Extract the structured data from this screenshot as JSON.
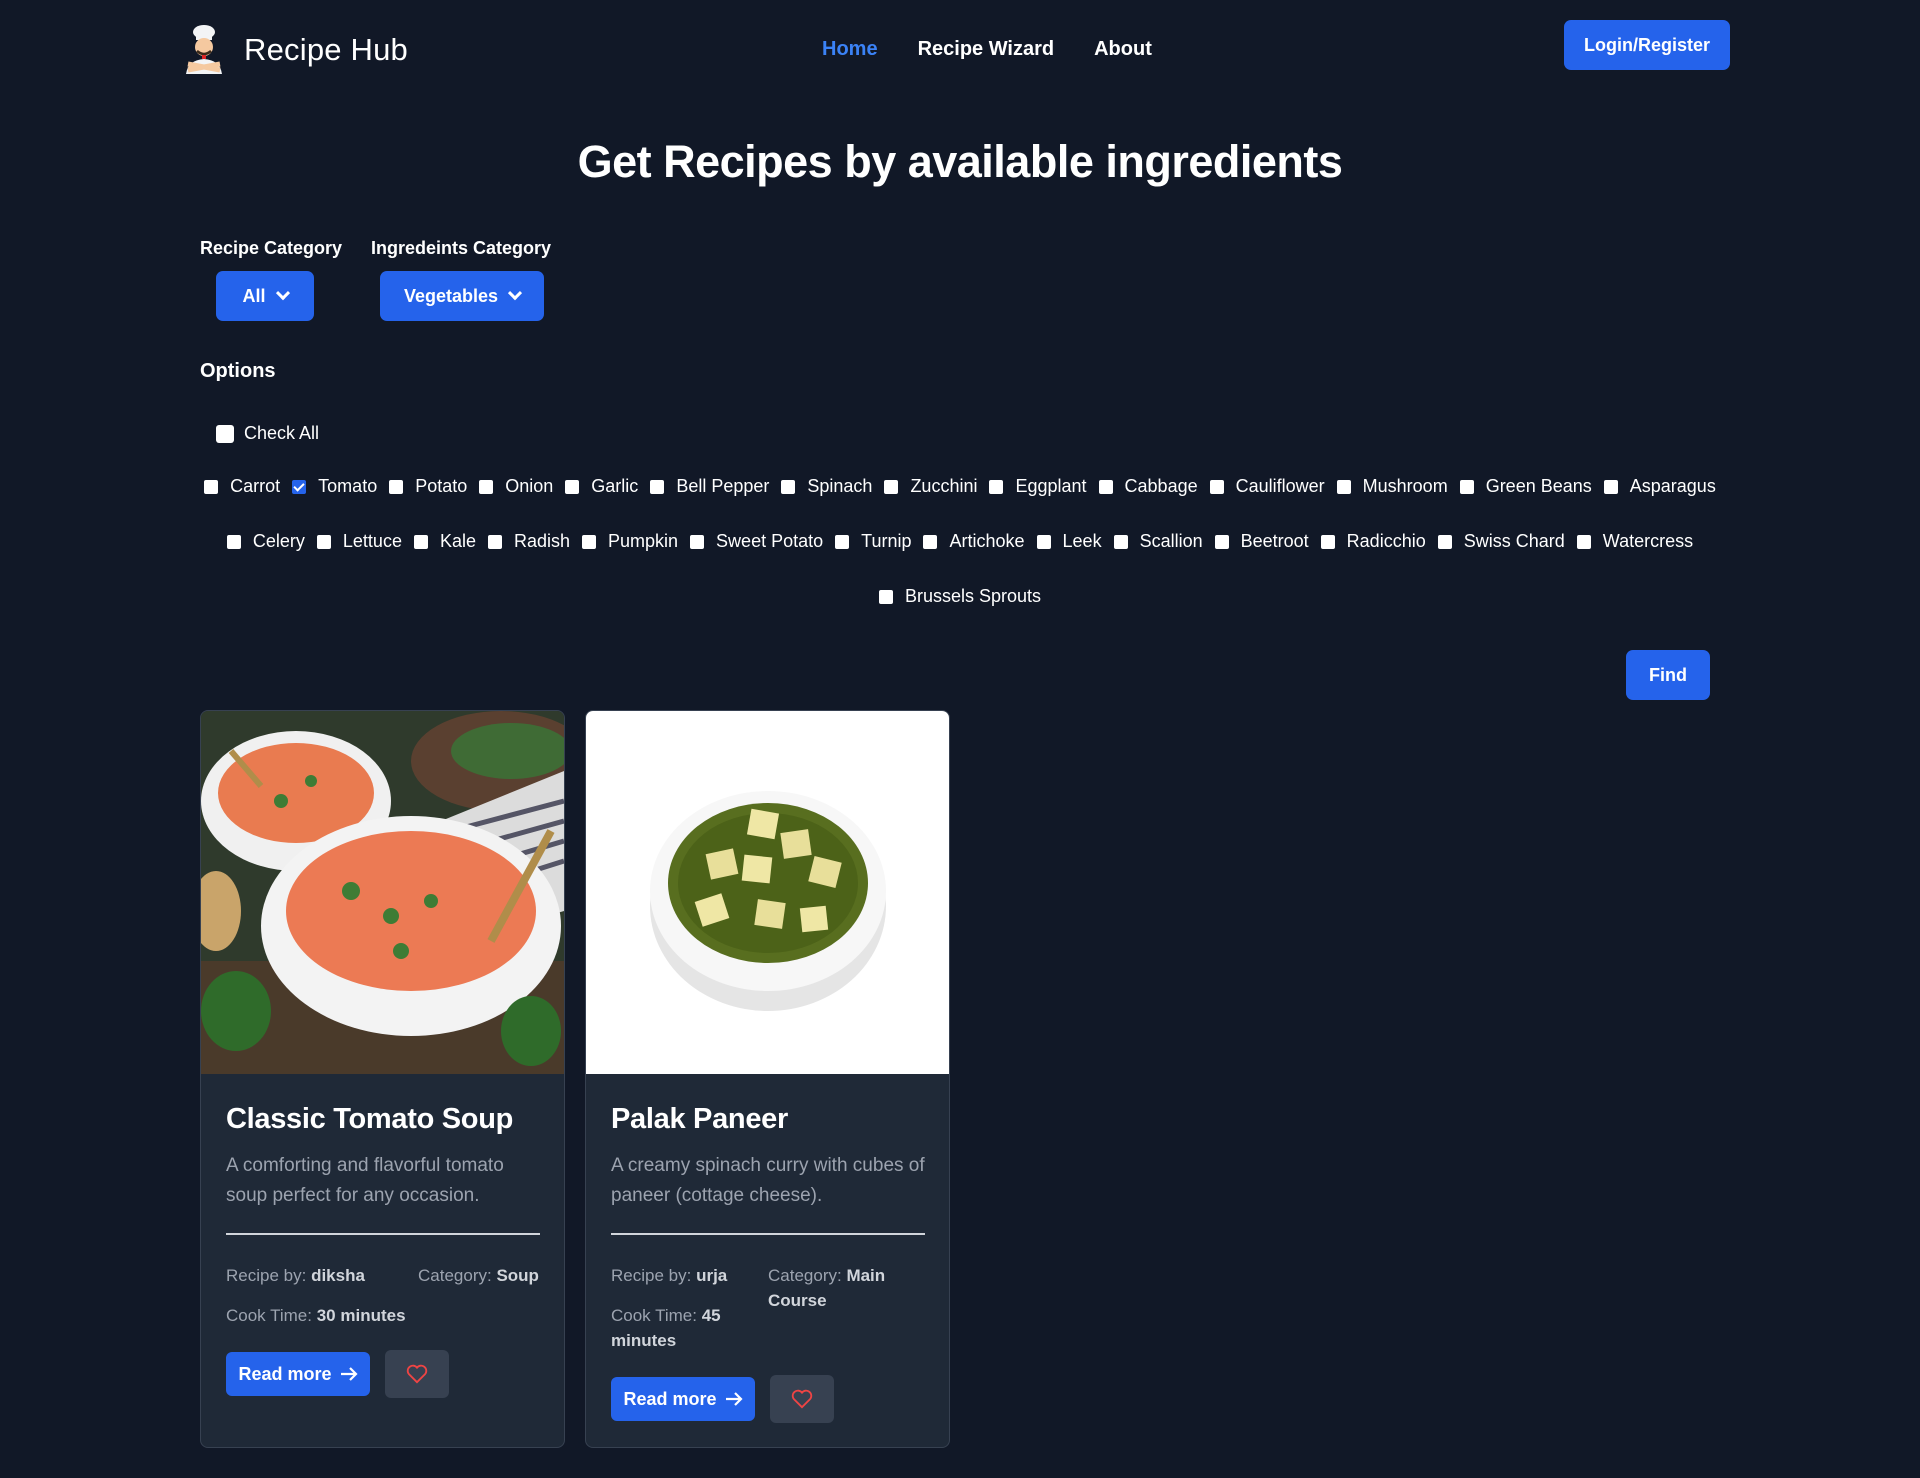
{
  "nav": {
    "brand": "Recipe Hub",
    "links": [
      "Home",
      "Recipe Wizard",
      "About"
    ],
    "login": "Login/Register"
  },
  "title": "Get Recipes by available ingredients",
  "filters": {
    "recipe_category_label": "Recipe Category",
    "recipe_category_value": "All",
    "ingredients_category_label": "Ingredeints Category",
    "ingredients_category_value": "Vegetables"
  },
  "options": {
    "title": "Options",
    "check_all": "Check All",
    "ingredients_row1": [
      "Carrot",
      "Tomato",
      "Potato",
      "Onion",
      "Garlic",
      "Bell Pepper",
      "Spinach",
      "Zucchini",
      "Eggplant",
      "Cabbage",
      "Cauliflower",
      "Mushroom",
      "Green Beans",
      "Asparagus"
    ],
    "ingredients_row2": [
      "Celery",
      "Lettuce",
      "Kale",
      "Radish",
      "Pumpkin",
      "Sweet Potato",
      "Turnip",
      "Artichoke",
      "Leek",
      "Scallion",
      "Beetroot",
      "Radicchio",
      "Swiss Chard",
      "Watercress"
    ],
    "ingredients_row3": [
      "Brussels Sprouts"
    ],
    "checked": [
      "Tomato"
    ]
  },
  "find_label": "Find",
  "cards": [
    {
      "title": "Classic Tomato Soup",
      "description": "A comforting and flavorful tomato soup perfect for any occasion.",
      "recipe_by_label": "Recipe by:",
      "author": "diksha",
      "category_label": "Category:",
      "category": "Soup",
      "cook_time_label": "Cook Time:",
      "cook_time": "30 minutes",
      "read_more": "Read more"
    },
    {
      "title": "Palak Paneer",
      "description": "A creamy spinach curry with cubes of paneer (cottage cheese).",
      "recipe_by_label": "Recipe by:",
      "author": "urja",
      "category_label": "Category:",
      "category": "Main Course",
      "cook_time_label": "Cook Time:",
      "cook_time": "45 minutes",
      "read_more": "Read more"
    }
  ]
}
